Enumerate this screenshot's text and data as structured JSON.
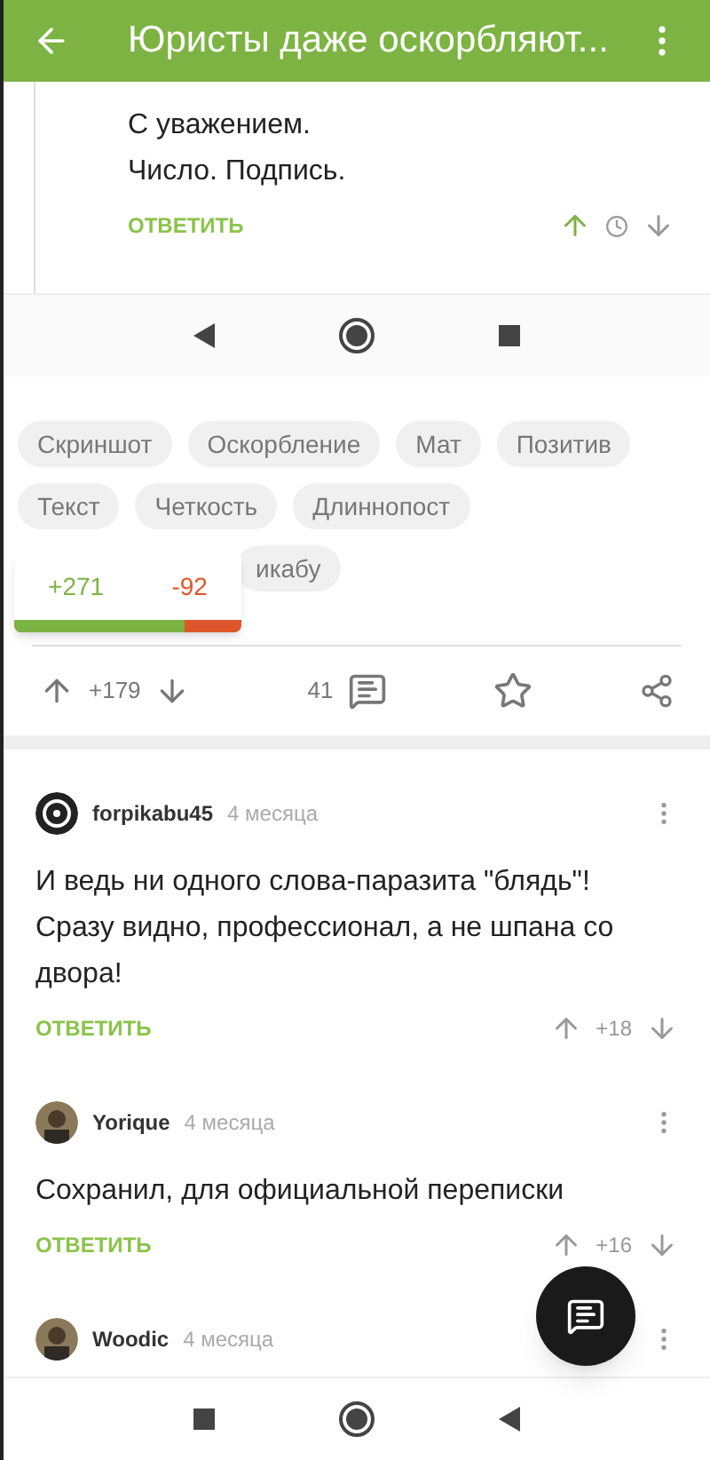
{
  "app_bar": {
    "title": "Юристы даже оскорбляют..."
  },
  "post_image": {
    "lines": [
      "С уважением.",
      "Число. Подпись."
    ],
    "reply": "ОТВЕТИТЬ",
    "upvoted": true
  },
  "tag_rows": [
    [
      {
        "label": "Скриншот"
      },
      {
        "label": "Оскорбление"
      },
      {
        "label": "Мат"
      },
      {
        "label": "Позитив"
      }
    ],
    [
      {
        "label": "Текст"
      },
      {
        "label": "Четкость"
      },
      {
        "label": "Длиннопост"
      }
    ],
    [
      {
        "label": "икабу"
      }
    ]
  ],
  "rating_popup": {
    "plus": "+271",
    "minus": "-92",
    "level": 0.75
  },
  "post_actions": {
    "rating": "+179",
    "comments": "41"
  },
  "comments": [
    {
      "author": "forpikabu45",
      "time": "4 месяца",
      "avatar": {
        "kind": "logo"
      },
      "text": "И ведь ни одного слова-паразита \"блядь\"! Сразу видно, профессионал, а не шпана со двора!",
      "reply": "ОТВЕТИТЬ",
      "rating": "+18"
    },
    {
      "author": "Yorique",
      "time": "4 месяца",
      "text": "Сохранил, для официальной переписки",
      "reply": "ОТВЕТИТЬ",
      "rating": "+16"
    },
    {
      "author": "Woodic",
      "time": "4 месяца"
    }
  ]
}
